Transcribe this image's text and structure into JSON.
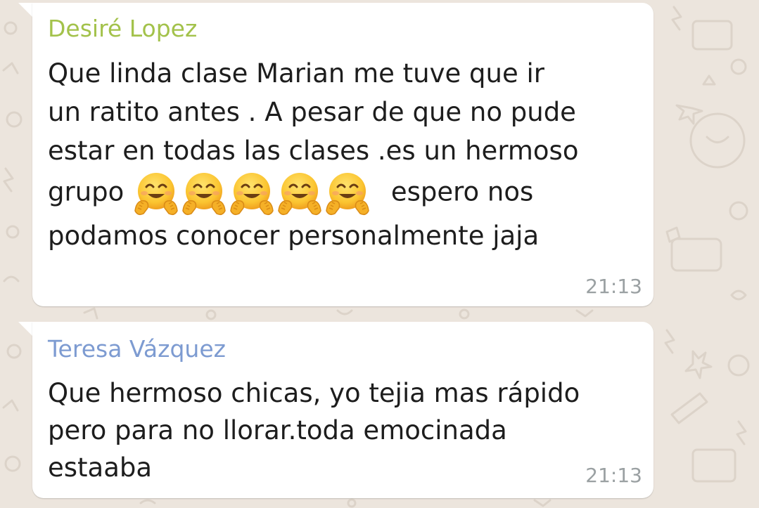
{
  "chat": {
    "messages": [
      {
        "sender": "Desiré Lopez",
        "sender_color": "#a3c24b",
        "lines": [
          "Que linda clase Marian  me tuve que ir",
          "un ratito antes . A pesar de que no pude",
          "estar en todas las clases .es un  hermoso",
          "grupo",
          "espero nos",
          "podamos conocer personalmente jaja"
        ],
        "emoji": "hugging-face-emoji",
        "emoji_count": 5,
        "time": "21:13"
      },
      {
        "sender": "Teresa Vázquez",
        "sender_color": "#7d9bd1",
        "lines": [
          "Que hermoso chicas, yo tejia mas rápido",
          "pero para no llorar.toda emocinada",
          "estaaba"
        ],
        "time": "21:13"
      }
    ]
  },
  "colors": {
    "background": "#ece5dd",
    "bubble": "#ffffff",
    "timestamp": "#9aa0a2"
  }
}
